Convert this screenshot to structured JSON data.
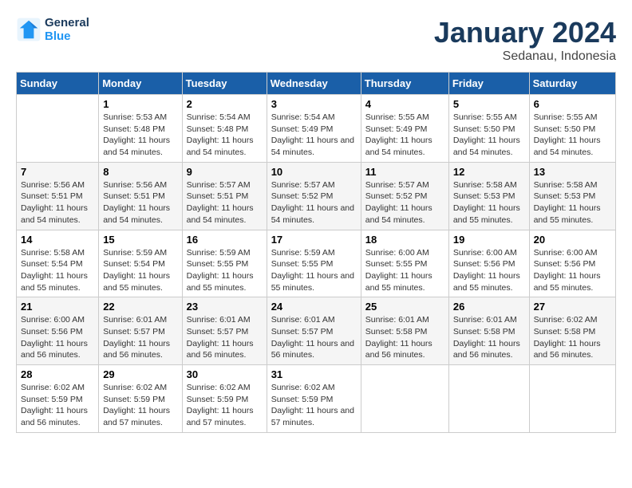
{
  "logo": {
    "line1": "General",
    "line2": "Blue"
  },
  "title": "January 2024",
  "subtitle": "Sedanau, Indonesia",
  "weekdays": [
    "Sunday",
    "Monday",
    "Tuesday",
    "Wednesday",
    "Thursday",
    "Friday",
    "Saturday"
  ],
  "weeks": [
    [
      {
        "num": "",
        "sunrise": "",
        "sunset": "",
        "daylight": ""
      },
      {
        "num": "1",
        "sunrise": "Sunrise: 5:53 AM",
        "sunset": "Sunset: 5:48 PM",
        "daylight": "Daylight: 11 hours and 54 minutes."
      },
      {
        "num": "2",
        "sunrise": "Sunrise: 5:54 AM",
        "sunset": "Sunset: 5:48 PM",
        "daylight": "Daylight: 11 hours and 54 minutes."
      },
      {
        "num": "3",
        "sunrise": "Sunrise: 5:54 AM",
        "sunset": "Sunset: 5:49 PM",
        "daylight": "Daylight: 11 hours and 54 minutes."
      },
      {
        "num": "4",
        "sunrise": "Sunrise: 5:55 AM",
        "sunset": "Sunset: 5:49 PM",
        "daylight": "Daylight: 11 hours and 54 minutes."
      },
      {
        "num": "5",
        "sunrise": "Sunrise: 5:55 AM",
        "sunset": "Sunset: 5:50 PM",
        "daylight": "Daylight: 11 hours and 54 minutes."
      },
      {
        "num": "6",
        "sunrise": "Sunrise: 5:55 AM",
        "sunset": "Sunset: 5:50 PM",
        "daylight": "Daylight: 11 hours and 54 minutes."
      }
    ],
    [
      {
        "num": "7",
        "sunrise": "Sunrise: 5:56 AM",
        "sunset": "Sunset: 5:51 PM",
        "daylight": "Daylight: 11 hours and 54 minutes."
      },
      {
        "num": "8",
        "sunrise": "Sunrise: 5:56 AM",
        "sunset": "Sunset: 5:51 PM",
        "daylight": "Daylight: 11 hours and 54 minutes."
      },
      {
        "num": "9",
        "sunrise": "Sunrise: 5:57 AM",
        "sunset": "Sunset: 5:51 PM",
        "daylight": "Daylight: 11 hours and 54 minutes."
      },
      {
        "num": "10",
        "sunrise": "Sunrise: 5:57 AM",
        "sunset": "Sunset: 5:52 PM",
        "daylight": "Daylight: 11 hours and 54 minutes."
      },
      {
        "num": "11",
        "sunrise": "Sunrise: 5:57 AM",
        "sunset": "Sunset: 5:52 PM",
        "daylight": "Daylight: 11 hours and 54 minutes."
      },
      {
        "num": "12",
        "sunrise": "Sunrise: 5:58 AM",
        "sunset": "Sunset: 5:53 PM",
        "daylight": "Daylight: 11 hours and 55 minutes."
      },
      {
        "num": "13",
        "sunrise": "Sunrise: 5:58 AM",
        "sunset": "Sunset: 5:53 PM",
        "daylight": "Daylight: 11 hours and 55 minutes."
      }
    ],
    [
      {
        "num": "14",
        "sunrise": "Sunrise: 5:58 AM",
        "sunset": "Sunset: 5:54 PM",
        "daylight": "Daylight: 11 hours and 55 minutes."
      },
      {
        "num": "15",
        "sunrise": "Sunrise: 5:59 AM",
        "sunset": "Sunset: 5:54 PM",
        "daylight": "Daylight: 11 hours and 55 minutes."
      },
      {
        "num": "16",
        "sunrise": "Sunrise: 5:59 AM",
        "sunset": "Sunset: 5:55 PM",
        "daylight": "Daylight: 11 hours and 55 minutes."
      },
      {
        "num": "17",
        "sunrise": "Sunrise: 5:59 AM",
        "sunset": "Sunset: 5:55 PM",
        "daylight": "Daylight: 11 hours and 55 minutes."
      },
      {
        "num": "18",
        "sunrise": "Sunrise: 6:00 AM",
        "sunset": "Sunset: 5:55 PM",
        "daylight": "Daylight: 11 hours and 55 minutes."
      },
      {
        "num": "19",
        "sunrise": "Sunrise: 6:00 AM",
        "sunset": "Sunset: 5:56 PM",
        "daylight": "Daylight: 11 hours and 55 minutes."
      },
      {
        "num": "20",
        "sunrise": "Sunrise: 6:00 AM",
        "sunset": "Sunset: 5:56 PM",
        "daylight": "Daylight: 11 hours and 55 minutes."
      }
    ],
    [
      {
        "num": "21",
        "sunrise": "Sunrise: 6:00 AM",
        "sunset": "Sunset: 5:56 PM",
        "daylight": "Daylight: 11 hours and 56 minutes."
      },
      {
        "num": "22",
        "sunrise": "Sunrise: 6:01 AM",
        "sunset": "Sunset: 5:57 PM",
        "daylight": "Daylight: 11 hours and 56 minutes."
      },
      {
        "num": "23",
        "sunrise": "Sunrise: 6:01 AM",
        "sunset": "Sunset: 5:57 PM",
        "daylight": "Daylight: 11 hours and 56 minutes."
      },
      {
        "num": "24",
        "sunrise": "Sunrise: 6:01 AM",
        "sunset": "Sunset: 5:57 PM",
        "daylight": "Daylight: 11 hours and 56 minutes."
      },
      {
        "num": "25",
        "sunrise": "Sunrise: 6:01 AM",
        "sunset": "Sunset: 5:58 PM",
        "daylight": "Daylight: 11 hours and 56 minutes."
      },
      {
        "num": "26",
        "sunrise": "Sunrise: 6:01 AM",
        "sunset": "Sunset: 5:58 PM",
        "daylight": "Daylight: 11 hours and 56 minutes."
      },
      {
        "num": "27",
        "sunrise": "Sunrise: 6:02 AM",
        "sunset": "Sunset: 5:58 PM",
        "daylight": "Daylight: 11 hours and 56 minutes."
      }
    ],
    [
      {
        "num": "28",
        "sunrise": "Sunrise: 6:02 AM",
        "sunset": "Sunset: 5:59 PM",
        "daylight": "Daylight: 11 hours and 56 minutes."
      },
      {
        "num": "29",
        "sunrise": "Sunrise: 6:02 AM",
        "sunset": "Sunset: 5:59 PM",
        "daylight": "Daylight: 11 hours and 57 minutes."
      },
      {
        "num": "30",
        "sunrise": "Sunrise: 6:02 AM",
        "sunset": "Sunset: 5:59 PM",
        "daylight": "Daylight: 11 hours and 57 minutes."
      },
      {
        "num": "31",
        "sunrise": "Sunrise: 6:02 AM",
        "sunset": "Sunset: 5:59 PM",
        "daylight": "Daylight: 11 hours and 57 minutes."
      },
      {
        "num": "",
        "sunrise": "",
        "sunset": "",
        "daylight": ""
      },
      {
        "num": "",
        "sunrise": "",
        "sunset": "",
        "daylight": ""
      },
      {
        "num": "",
        "sunrise": "",
        "sunset": "",
        "daylight": ""
      }
    ]
  ]
}
